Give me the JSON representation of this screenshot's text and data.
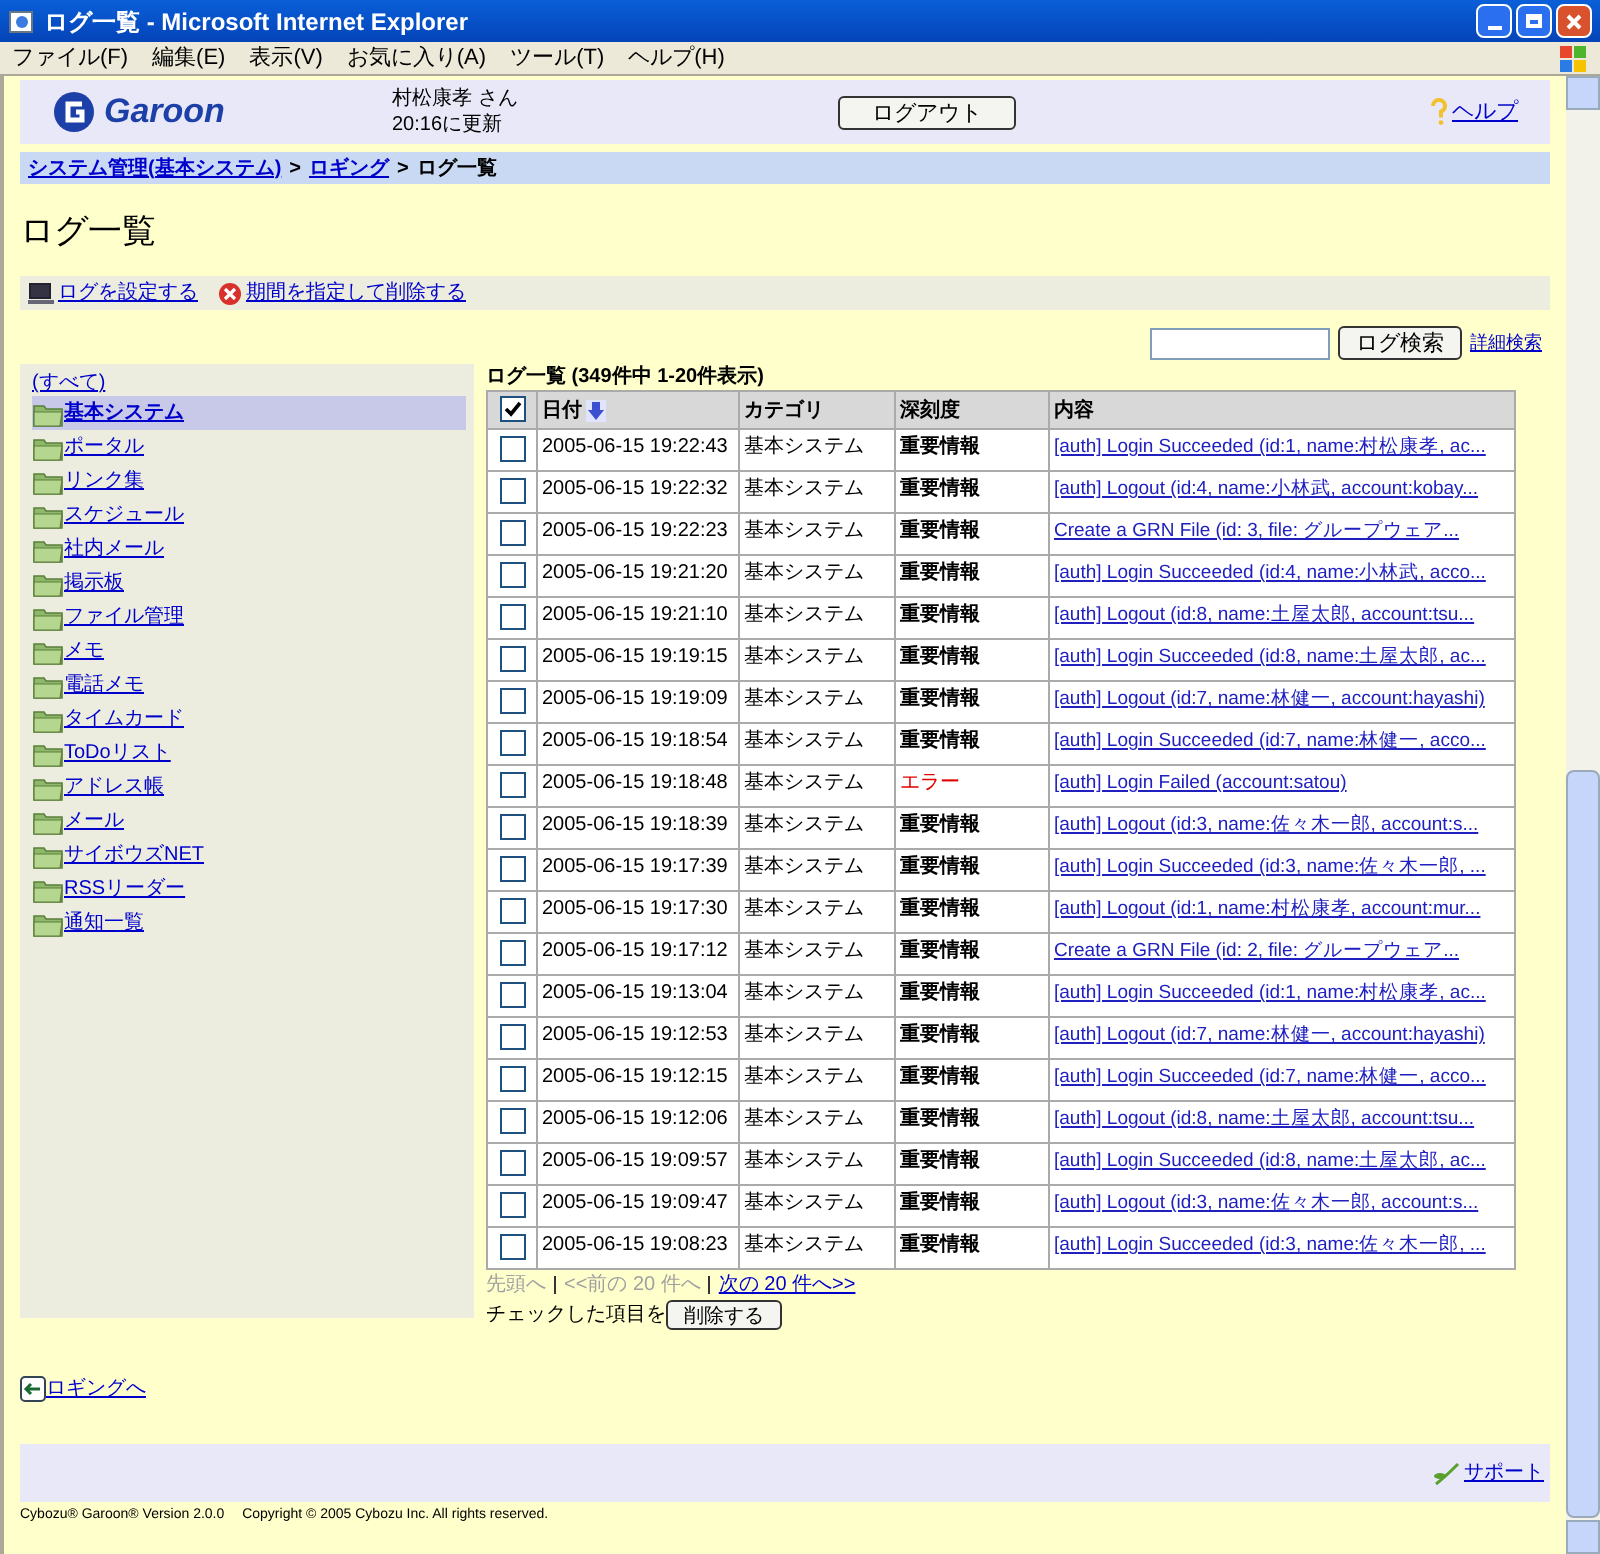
{
  "window": {
    "title": "ログ一覧 - Microsoft Internet Explorer"
  },
  "menu": [
    "ファイル(F)",
    "編集(E)",
    "表示(V)",
    "お気に入り(A)",
    "ツール(T)",
    "ヘルプ(H)"
  ],
  "header": {
    "logo": "Garoon",
    "user": "村松康孝 さん",
    "updated": "20:16に更新",
    "logout": "ログアウト",
    "help": "ヘルプ"
  },
  "breadcrumb": [
    {
      "label": "システム管理(基本システム)",
      "link": true
    },
    {
      "label": ">",
      "link": false
    },
    {
      "label": "ロギング",
      "link": true
    },
    {
      "label": ">",
      "link": false
    },
    {
      "label": "ログ一覧",
      "link": false
    }
  ],
  "page_title": "ログ一覧",
  "actions": [
    {
      "kind": "settings",
      "label": "ログを設定する"
    },
    {
      "kind": "delete",
      "label": "期間を指定して削除する"
    }
  ],
  "search": {
    "button": "ログ検索",
    "advanced": "詳細検索"
  },
  "sidebar": {
    "all": "(すべて)",
    "items": [
      {
        "label": "基本システム",
        "selected": true
      },
      {
        "label": "ポータル",
        "selected": false
      },
      {
        "label": "リンク集",
        "selected": false
      },
      {
        "label": "スケジュール",
        "selected": false
      },
      {
        "label": "社内メール",
        "selected": false
      },
      {
        "label": "掲示板",
        "selected": false
      },
      {
        "label": "ファイル管理",
        "selected": false
      },
      {
        "label": "メモ",
        "selected": false
      },
      {
        "label": "電話メモ",
        "selected": false
      },
      {
        "label": "タイムカード",
        "selected": false
      },
      {
        "label": "ToDoリスト",
        "selected": false
      },
      {
        "label": "アドレス帳",
        "selected": false
      },
      {
        "label": "メール",
        "selected": false
      },
      {
        "label": "サイボウズNET",
        "selected": false
      },
      {
        "label": "RSSリーダー",
        "selected": false
      },
      {
        "label": "通知一覧",
        "selected": false
      }
    ]
  },
  "table": {
    "caption": "ログ一覧 (349件中 1-20件表示)",
    "select_all": {
      "checked": true
    },
    "columns": [
      "日付",
      "カテゴリ",
      "深刻度",
      "内容"
    ],
    "rows": [
      {
        "checked": false,
        "date": "2005-06-15 19:22:43",
        "category": "基本システム",
        "kind": "info",
        "severity": "重要情報",
        "content": "[auth] Login Succeeded (id:1, name:村松康孝, ac..."
      },
      {
        "checked": false,
        "date": "2005-06-15 19:22:32",
        "category": "基本システム",
        "kind": "info",
        "severity": "重要情報",
        "content": "[auth] Logout (id:4, name:小林武, account:kobay..."
      },
      {
        "checked": false,
        "date": "2005-06-15 19:22:23",
        "category": "基本システム",
        "kind": "info",
        "severity": "重要情報",
        "content": "Create a GRN File (id: 3, file: グループウェア..."
      },
      {
        "checked": false,
        "date": "2005-06-15 19:21:20",
        "category": "基本システム",
        "kind": "info",
        "severity": "重要情報",
        "content": "[auth] Login Succeeded (id:4, name:小林武, acco..."
      },
      {
        "checked": false,
        "date": "2005-06-15 19:21:10",
        "category": "基本システム",
        "kind": "info",
        "severity": "重要情報",
        "content": "[auth] Logout (id:8, name:土屋太郎, account:tsu..."
      },
      {
        "checked": false,
        "date": "2005-06-15 19:19:15",
        "category": "基本システム",
        "kind": "info",
        "severity": "重要情報",
        "content": "[auth] Login Succeeded (id:8, name:土屋太郎, ac..."
      },
      {
        "checked": false,
        "date": "2005-06-15 19:19:09",
        "category": "基本システム",
        "kind": "info",
        "severity": "重要情報",
        "content": "[auth] Logout (id:7, name:林健一, account:hayashi)"
      },
      {
        "checked": false,
        "date": "2005-06-15 19:18:54",
        "category": "基本システム",
        "kind": "info",
        "severity": "重要情報",
        "content": "[auth] Login Succeeded (id:7, name:林健一, acco..."
      },
      {
        "checked": false,
        "date": "2005-06-15 19:18:48",
        "category": "基本システム",
        "kind": "error",
        "severity": "エラー",
        "content": "[auth] Login Failed (account:satou)"
      },
      {
        "checked": false,
        "date": "2005-06-15 19:18:39",
        "category": "基本システム",
        "kind": "info",
        "severity": "重要情報",
        "content": "[auth] Logout (id:3, name:佐々木一郎, account:s..."
      },
      {
        "checked": false,
        "date": "2005-06-15 19:17:39",
        "category": "基本システム",
        "kind": "info",
        "severity": "重要情報",
        "content": "[auth] Login Succeeded (id:3, name:佐々木一郎, ..."
      },
      {
        "checked": false,
        "date": "2005-06-15 19:17:30",
        "category": "基本システム",
        "kind": "info",
        "severity": "重要情報",
        "content": "[auth] Logout (id:1, name:村松康孝, account:mur..."
      },
      {
        "checked": false,
        "date": "2005-06-15 19:17:12",
        "category": "基本システム",
        "kind": "info",
        "severity": "重要情報",
        "content": "Create a GRN File (id: 2, file: グループウェア..."
      },
      {
        "checked": false,
        "date": "2005-06-15 19:13:04",
        "category": "基本システム",
        "kind": "info",
        "severity": "重要情報",
        "content": "[auth] Login Succeeded (id:1, name:村松康孝, ac..."
      },
      {
        "checked": false,
        "date": "2005-06-15 19:12:53",
        "category": "基本システム",
        "kind": "info",
        "severity": "重要情報",
        "content": "[auth] Logout (id:7, name:林健一, account:hayashi)"
      },
      {
        "checked": false,
        "date": "2005-06-15 19:12:15",
        "category": "基本システム",
        "kind": "info",
        "severity": "重要情報",
        "content": "[auth] Login Succeeded (id:7, name:林健一, acco..."
      },
      {
        "checked": false,
        "date": "2005-06-15 19:12:06",
        "category": "基本システム",
        "kind": "info",
        "severity": "重要情報",
        "content": "[auth] Logout (id:8, name:土屋太郎, account:tsu..."
      },
      {
        "checked": false,
        "date": "2005-06-15 19:09:57",
        "category": "基本システム",
        "kind": "info",
        "severity": "重要情報",
        "content": "[auth] Login Succeeded (id:8, name:土屋太郎, ac..."
      },
      {
        "checked": false,
        "date": "2005-06-15 19:09:47",
        "category": "基本システム",
        "kind": "info",
        "severity": "重要情報",
        "content": "[auth] Logout (id:3, name:佐々木一郎, account:s..."
      },
      {
        "checked": false,
        "date": "2005-06-15 19:08:23",
        "category": "基本システム",
        "kind": "info",
        "severity": "重要情報",
        "content": "[auth] Login Succeeded (id:3, name:佐々木一郎, ..."
      }
    ]
  },
  "pagination": [
    {
      "label": "先頭へ",
      "disabled": true
    },
    {
      "label": "<<前の 20 件へ",
      "disabled": true
    },
    {
      "label": "次の 20 件へ>>",
      "disabled": false
    }
  ],
  "bulk": {
    "label": "チェックした項目を",
    "button": "削除する"
  },
  "back_link": "ロギングへ",
  "footer": {
    "support": "サポート",
    "copyright": "Cybozu® Garoon® Version 2.0.0　 Copyright © 2005 Cybozu Inc. All rights reserved."
  }
}
